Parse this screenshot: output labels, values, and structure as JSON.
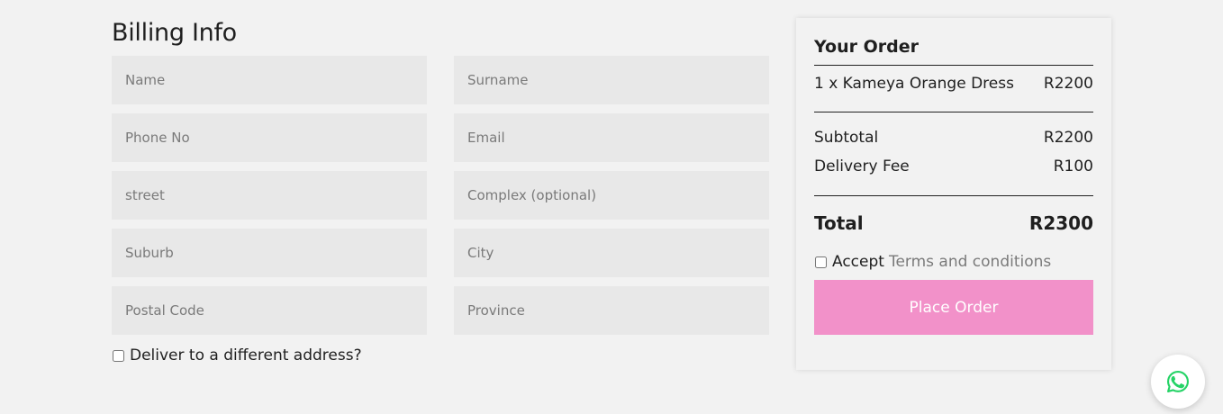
{
  "billing": {
    "title": "Billing Info",
    "fields": {
      "name": "Name",
      "surname": "Surname",
      "phone": "Phone No",
      "email": "Email",
      "street": "street",
      "complex": "Complex (optional)",
      "suburb": "Suburb",
      "city": "City",
      "postal_code": "Postal Code",
      "province": "Province"
    },
    "different_address_label": "Deliver to a different address?"
  },
  "order": {
    "title": "Your Order",
    "item": {
      "label": "1 x Kameya Orange Dress",
      "price": "R2200"
    },
    "subtotal_label": "Subtotal",
    "subtotal_value": "R2200",
    "delivery_label": "Delivery Fee",
    "delivery_value": "R100",
    "total_label": "Total",
    "total_value": "R2300",
    "accept_label": "Accept",
    "terms_link": "Terms and conditions",
    "place_order_label": "Place Order"
  },
  "colors": {
    "button": "#f291c9",
    "whatsapp": "#25d366"
  },
  "icons": {
    "chat": "whatsapp-icon"
  }
}
